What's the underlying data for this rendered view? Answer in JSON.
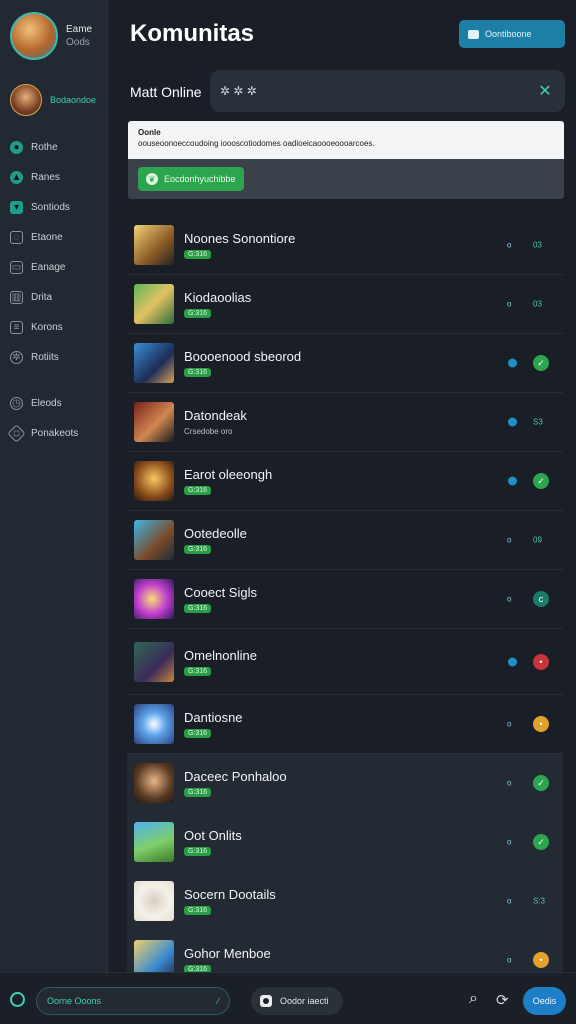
{
  "profile": {
    "name": "Eame",
    "sub": "Oods",
    "name2": "Bodaondoe"
  },
  "sidebar": {
    "items": [
      {
        "label": "Rothe",
        "icon": "home-icon"
      },
      {
        "label": "Ranes",
        "icon": "store-icon"
      },
      {
        "label": "Sontiods",
        "icon": "chat-icon"
      },
      {
        "label": "Etaone",
        "icon": "gamepad-icon"
      },
      {
        "label": "Eanage",
        "icon": "library-icon"
      },
      {
        "label": "Drita",
        "icon": "stats-icon"
      },
      {
        "label": "Korons",
        "icon": "news-icon"
      },
      {
        "label": "Rotiits",
        "icon": "settings-icon"
      },
      {
        "label": "Eleods",
        "icon": "clock-icon"
      },
      {
        "label": "Ponakeots",
        "icon": "tag-icon"
      }
    ]
  },
  "header": {
    "title": "Komunitas",
    "button": "Oontiboone"
  },
  "search": {
    "label": "Matt Online",
    "value": "✲ ✲ ✲"
  },
  "notice": {
    "heading": "Oonle",
    "text": "oouseoonoeccoudoing ioooscotiodomes oadioeicaoooeoooarcoes.",
    "button": "Eocdonhyuchibbe"
  },
  "games": [
    {
      "name": "Noones Sonontiore",
      "badge": "G:316",
      "meta": "o",
      "status_text": "03",
      "status_kind": "text"
    },
    {
      "name": "Kiodaoolias",
      "badge": "G:316",
      "meta": "o",
      "status_text": "03",
      "status_kind": "text"
    },
    {
      "name": "Boooenood sbeorod",
      "badge": "G:316",
      "meta": "•",
      "status_text": "✓",
      "status_kind": "green"
    },
    {
      "name": "Datondeak",
      "badge": "Crsedobe oro",
      "meta": "•",
      "status_text": "S3",
      "status_kind": "text"
    },
    {
      "name": "Earot oleeongh",
      "badge": "G:316",
      "meta": "•",
      "status_text": "✓",
      "status_kind": "green"
    },
    {
      "name": "Ootedeolle",
      "badge": "G:316",
      "meta": "o",
      "status_text": "09",
      "status_kind": "text"
    },
    {
      "name": "Cooect Sigls",
      "badge": "G:316",
      "meta": "o",
      "status_text": "c",
      "status_kind": "teal"
    },
    {
      "name": "Omelnonline",
      "badge": "G:316",
      "meta": "•",
      "status_text": "•",
      "status_kind": "red"
    },
    {
      "name": "Dantiosne",
      "badge": "G:316",
      "meta": "o",
      "status_text": "•",
      "status_kind": "orange"
    },
    {
      "name": "Daceec Ponhaloo",
      "badge": "G:316",
      "meta": "o",
      "status_text": "✓",
      "status_kind": "green"
    },
    {
      "name": "Oot Onlits",
      "badge": "G:316",
      "meta": "o",
      "status_text": "✓",
      "status_kind": "green"
    },
    {
      "name": "Socern Dootails",
      "badge": "G:316",
      "meta": "o",
      "status_text": "S:3",
      "status_kind": "text"
    },
    {
      "name": "Gohor Menboe",
      "badge": "G:316",
      "meta": "o",
      "status_text": "•",
      "status_kind": "orange"
    }
  ],
  "bottom": {
    "input_value": "Oorne Ooons",
    "pill": "Oodor iaecti",
    "button": "Oedis"
  },
  "colors": {
    "accent": "#3fd0b4",
    "primary": "#1e7fa6",
    "green": "#2da44e"
  }
}
